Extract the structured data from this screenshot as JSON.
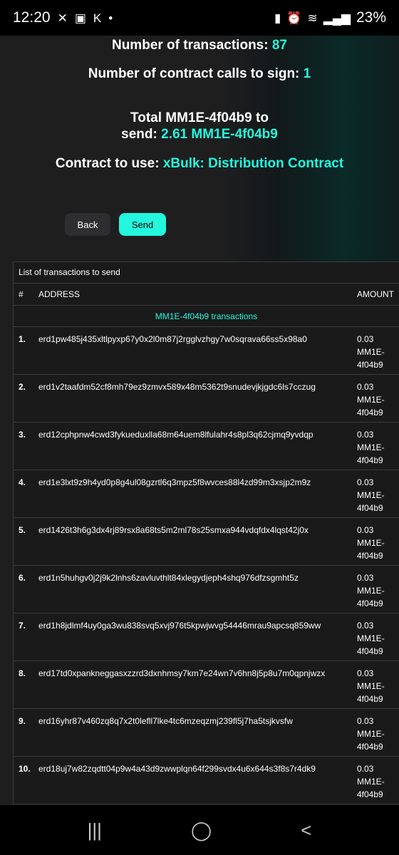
{
  "status_bar": {
    "time": "12:20",
    "battery": "23%",
    "left_icons": [
      "x-icon",
      "image-icon",
      "kraken-icon",
      "dot-icon"
    ],
    "right_icons": [
      "battery-saver-icon",
      "alarm-icon",
      "wifi-icon",
      "signal-icon"
    ]
  },
  "summary": {
    "tx_label": "Number of transactions:",
    "tx_value": "87",
    "calls_label": "Number of contract calls to sign:",
    "calls_value": "1",
    "total_label": "Total MM1E-4f04b9 to send:",
    "total_value": "2.61 MM1E-4f04b9",
    "contract_label": "Contract to use:",
    "contract_value": "xBulk: Distribution Contract"
  },
  "buttons": {
    "back": "Back",
    "send": "Send"
  },
  "table": {
    "caption": "List of transactions to send",
    "headers": {
      "num": "#",
      "address": "ADDRESS",
      "amount": "AMOUNT"
    },
    "group_label": "MM1E-4f04b9 transactions",
    "rows": [
      {
        "num": "1.",
        "address": "erd1pw485j435xltlpyxp67y0x2l0m87j2rgglvzhgy7w0sqrava66ss5x98a0",
        "amount": "0.03",
        "token": "MM1E-",
        "token2": "4f04b9"
      },
      {
        "num": "2.",
        "address": "erd1v2taafdm52cf8mh79ez9zmvx589x48m5362t9snudevjkjgdc6ls7cczug",
        "amount": "0.03",
        "token": "MM1E-",
        "token2": "4f04b9"
      },
      {
        "num": "3.",
        "address": "erd12cphpnw4cwd3fykueduxlla68m64uem8lfulahr4s8pl3q62cjmq9yvdqp",
        "amount": "0.03",
        "token": "MM1E-",
        "token2": "4f04b9"
      },
      {
        "num": "4.",
        "address": "erd1e3lxt9z9h4yd0p8g4ul08gzrtl6q3mpz5f8wvces88l4zd99m3xsjp2m9z",
        "amount": "0.03",
        "token": "MM1E-",
        "token2": "4f04b9"
      },
      {
        "num": "5.",
        "address": "erd1426t3h6g3dx4rj89rsx8a68ts5m2ml78s25smxa944vdqfdx4lqst42j0x",
        "amount": "0.03",
        "token": "MM1E-",
        "token2": "4f04b9"
      },
      {
        "num": "6.",
        "address": "erd1n5huhgv0j2j9k2lnhs6zavluvthlt84xlegydjeph4shq976dfzsgmht5z",
        "amount": "0.03",
        "token": "MM1E-",
        "token2": "4f04b9"
      },
      {
        "num": "7.",
        "address": "erd1h8jdlmf4uy0ga3wu838svq5xvj976t5kpwjwvg54446mrau9apcsq859ww",
        "amount": "0.03",
        "token": "MM1E-",
        "token2": "4f04b9"
      },
      {
        "num": "8.",
        "address": "erd17td0xpankneggasxzzrd3dxnhmsy7km7e24wn7v6hn8j5p8u7m0qpnjwzx",
        "amount": "0.03",
        "token": "MM1E-",
        "token2": "4f04b9"
      },
      {
        "num": "9.",
        "address": "erd16yhr87v460zq8q7x2t0lefll7lke4tc6mzeqzmj239fl5j7ha5tsjkvsfw",
        "amount": "0.03",
        "token": "MM1E-",
        "token2": "4f04b9"
      },
      {
        "num": "10.",
        "address": "erd18uj7w82zqdtt04p9w4a43d9zwwplqn64f299svdx4u6x644s3f8s7r4dk9",
        "amount": "0.03",
        "token": "MM1E-",
        "token2": "4f04b9"
      }
    ]
  },
  "nav_bar": {
    "icons": [
      "recents-icon",
      "home-icon",
      "back-icon"
    ]
  },
  "colors": {
    "accent": "#23f7dd",
    "panel": "#1e1e1f",
    "button_secondary": "#2e2e31"
  }
}
